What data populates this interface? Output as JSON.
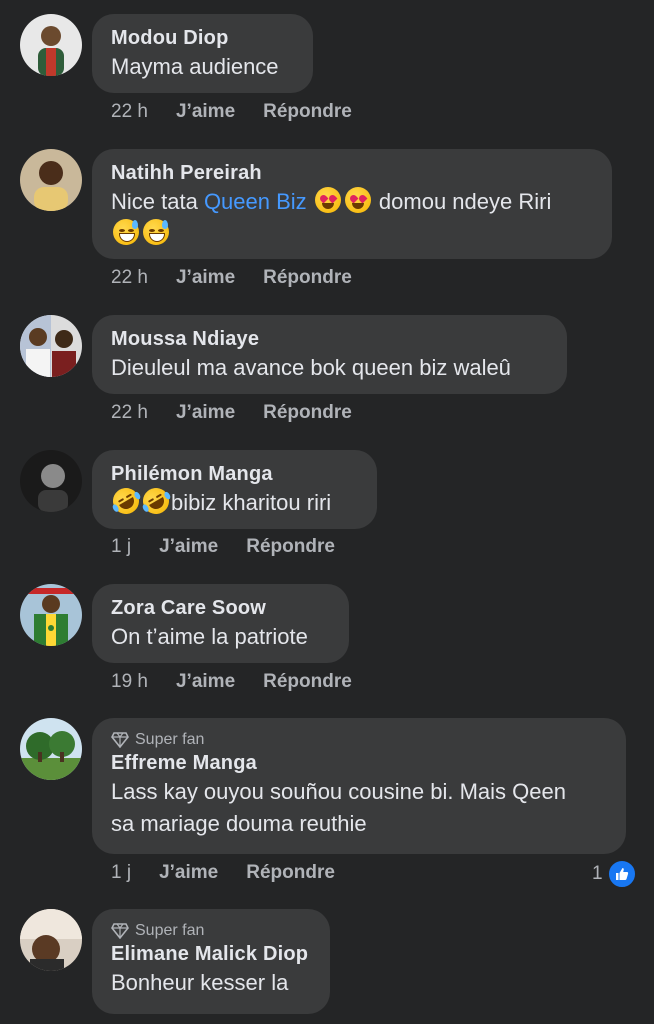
{
  "actions": {
    "like_label": "J’aime",
    "reply_label": "Répondre"
  },
  "comments": [
    {
      "author": "Modou Diop",
      "text": "Mayma audience",
      "time": "22 h"
    },
    {
      "author": "Natihh Pereirah",
      "text_before": "Nice tata ",
      "mention": "Queen Biz",
      "text_after": "domou ndeye Riri",
      "time": "22 h"
    },
    {
      "author": "Moussa Ndiaye",
      "text": "Dieuleul ma avance bok queen biz waleû",
      "time": "22 h"
    },
    {
      "author": "Philémon Manga",
      "text": "bibiz kharitou riri",
      "time": "1 j"
    },
    {
      "author": "Zora Care Soow",
      "text": "On t’aime la patriote",
      "time": "19 h"
    },
    {
      "badge": "Super fan",
      "author": "Effreme Manga",
      "text_line1": "Lass kay ouyou souñou cousine bi. Mais Qeen",
      "text_line2": "sa mariage douma reuthie",
      "time": "1 j",
      "reaction_count": "1"
    },
    {
      "badge": "Super fan",
      "author": "Elimane Malick Diop",
      "text": "Bonheur kesser la"
    }
  ],
  "icons": {
    "reaction": "like-thumb-icon",
    "badge": "diamond-icon"
  },
  "colors": {
    "background": "#242526",
    "bubble": "#3a3b3c",
    "mention": "#4599ff",
    "like": "#1877f2"
  }
}
